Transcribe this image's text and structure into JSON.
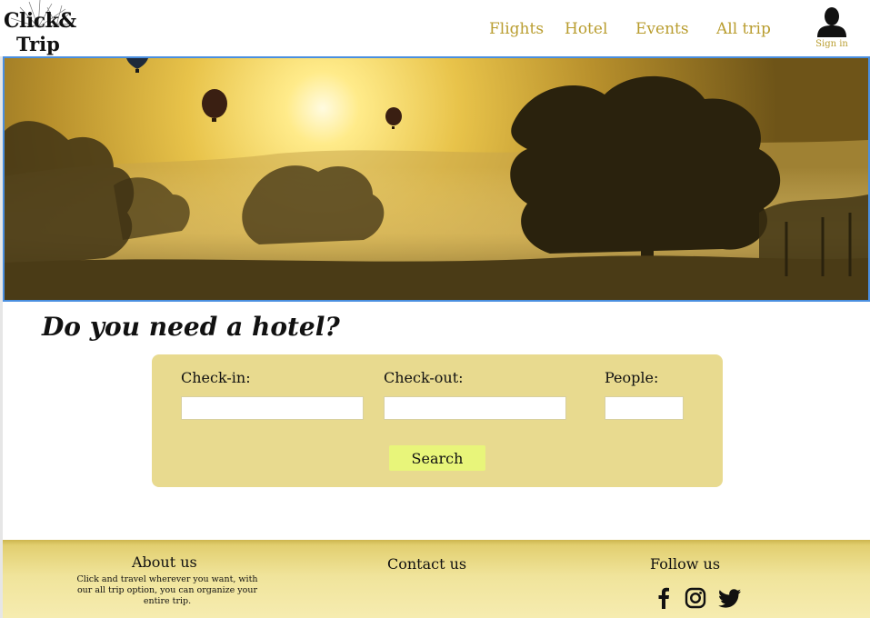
{
  "header": {
    "logo": {
      "line1": "Click&",
      "line2": "Trip"
    },
    "nav": [
      {
        "label": "Flights"
      },
      {
        "label": "Hotel"
      },
      {
        "label": "Events"
      },
      {
        "label": "All trip"
      }
    ],
    "signin_label": "Sign in",
    "signin_icon": "user-icon"
  },
  "hero": {
    "image": "hot-air-balloons-sunrise-landscape"
  },
  "main": {
    "title": "Do you need a hotel?",
    "form": {
      "checkin_label": "Check-in:",
      "checkin_value": "",
      "checkout_label": "Check-out:",
      "checkout_value": "",
      "people_label": "People:",
      "people_value": "",
      "search_label": "Search"
    }
  },
  "footer": {
    "about_title": "About us",
    "about_text": "Click and travel wherever you want, with our all trip option, you can organize your entire trip.",
    "contact_title": "Contact us",
    "follow_title": "Follow us",
    "social_icons": [
      "facebook-icon",
      "instagram-icon",
      "twitter-icon"
    ]
  },
  "colors": {
    "nav_text": "#b99d2f",
    "panel_bg": "#e8da8f",
    "search_button": "#e8f57a",
    "hero_border": "#4a8fe0"
  }
}
